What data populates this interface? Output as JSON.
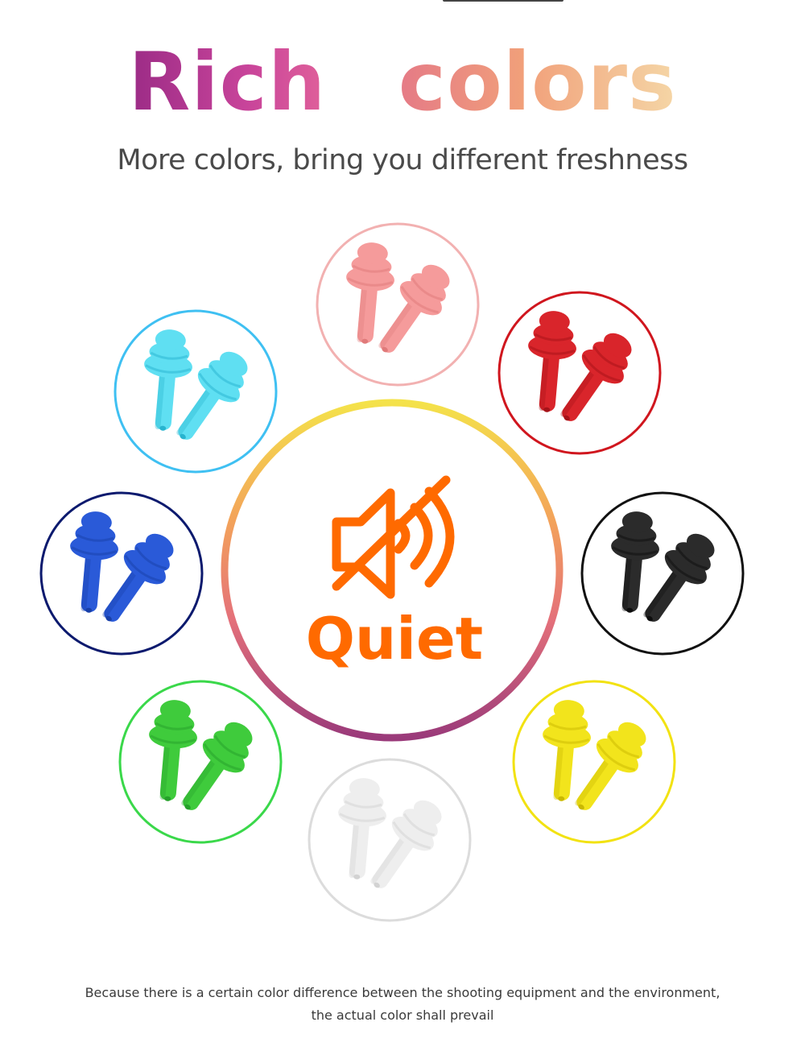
{
  "heading": {
    "word1": "Rich",
    "word2": "colors"
  },
  "subtitle": "More colors, bring you different freshness",
  "center": {
    "icon": "mute-speaker-icon",
    "label": "Quiet",
    "accent_color": "#ff6a00"
  },
  "color_options": [
    {
      "name": "pink",
      "ring": "#f2b1b1",
      "fill": "#f59b9b",
      "dark": "#e07a7a"
    },
    {
      "name": "red",
      "ring": "#d0161e",
      "fill": "#d9252b",
      "dark": "#a51218"
    },
    {
      "name": "black",
      "ring": "#111111",
      "fill": "#2b2b2b",
      "dark": "#0d0d0d"
    },
    {
      "name": "yellow",
      "ring": "#f2e212",
      "fill": "#f2e41c",
      "dark": "#c9b800"
    },
    {
      "name": "clear",
      "ring": "#dcdcdc",
      "fill": "#eeeeee",
      "dark": "#d2d2d2"
    },
    {
      "name": "green",
      "ring": "#3ad84a",
      "fill": "#3fcb3c",
      "dark": "#25a02a"
    },
    {
      "name": "blue",
      "ring": "#0c1a6e",
      "fill": "#2a5ad8",
      "dark": "#183fa8"
    },
    {
      "name": "cyan",
      "ring": "#3fc0f2",
      "fill": "#5fdff2",
      "dark": "#28b4cf"
    }
  ],
  "disclaimer": {
    "line1": "Because there is a certain color difference between the shooting equipment and the environment,",
    "line2": "the actual color shall prevail"
  }
}
